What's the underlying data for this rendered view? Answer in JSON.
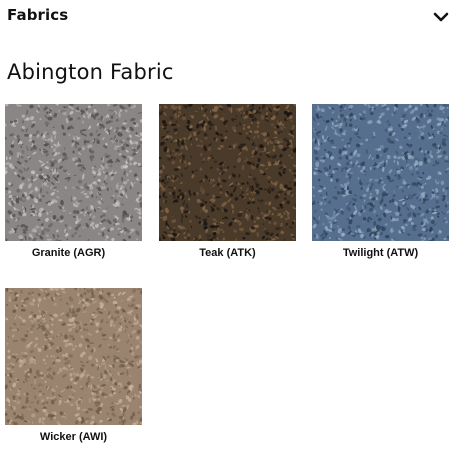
{
  "accordion": {
    "title": "Fabrics",
    "toggle_icon": "chevron-down-icon",
    "expanded": true
  },
  "section": {
    "title": "Abington Fabric"
  },
  "swatches": [
    {
      "label": "Granite (AGR)",
      "base": "#8a8686",
      "light": "#c9c6c4",
      "dark": "#4f4b4b"
    },
    {
      "label": "Teak (ATK)",
      "base": "#4a3a2a",
      "light": "#8a6a4a",
      "dark": "#141210"
    },
    {
      "label": "Twilight (ATW)",
      "base": "#566f8e",
      "light": "#9bb0c8",
      "dark": "#2c3e55"
    },
    {
      "label": "Wicker (AWI)",
      "base": "#9a8470",
      "light": "#c9b39c",
      "dark": "#6a5645"
    }
  ]
}
